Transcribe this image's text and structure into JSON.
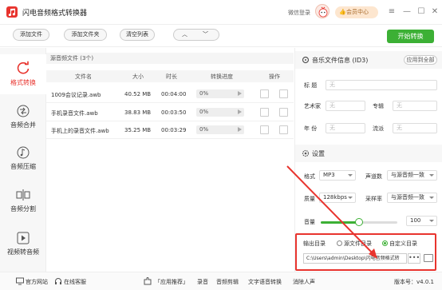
{
  "app": {
    "title": "闪电音频格式转换器",
    "wechat_login": "微信登录",
    "vip_center": "会员中心",
    "min_icon": "minimize-icon",
    "max_icon": "maximize-icon",
    "close_icon": "close-icon"
  },
  "toolbar": {
    "add_file": "添加文件",
    "add_folder": "添加文件夹",
    "clear_list": "清空列表",
    "up": "︿",
    "down": "﹀",
    "start": "开始转换"
  },
  "sidebar": {
    "items": [
      {
        "label": "格式转换",
        "icon": "refresh-icon",
        "active": true
      },
      {
        "label": "音频合并",
        "icon": "merge-icon",
        "active": false
      },
      {
        "label": "音频压缩",
        "icon": "music-note-icon",
        "active": false
      },
      {
        "label": "音频分割",
        "icon": "split-icon",
        "active": false
      },
      {
        "label": "视频转音频",
        "icon": "play-icon",
        "active": false
      }
    ]
  },
  "filelist": {
    "header": "源音频文件 (3个)",
    "columns": [
      "文件名",
      "大小",
      "时长",
      "转换进度",
      "操作"
    ],
    "rows": [
      {
        "name": "1009会议记录.awb",
        "size": "40.52 MB",
        "duration": "00:04:00",
        "progress": "0%",
        "progress_value": 0
      },
      {
        "name": "手机录音文件.awb",
        "size": "38.83 MB",
        "duration": "00:03:50",
        "progress": "0%",
        "progress_value": 0
      },
      {
        "name": "手机上的录音文件.awb",
        "size": "35.25 MB",
        "duration": "00:03:29",
        "progress": "0%",
        "progress_value": 0
      }
    ]
  },
  "info": {
    "title": "音乐文件信息 (ID3)",
    "apply_all": "应用到全部",
    "title_label": "标  题",
    "title_value": "无",
    "artist_label": "艺术家",
    "artist_value": "无",
    "album_label": "专辑",
    "album_value": "无",
    "year_label": "年  份",
    "year_value": "无",
    "genre_label": "流派",
    "genre_value": "无"
  },
  "settings": {
    "title": "设置",
    "format_label": "格式",
    "format_value": "MP3",
    "channels_label": "声道数",
    "channels_value": "与源音频一致",
    "quality_label": "质量",
    "quality_value": "128kbps",
    "samplerate_label": "采样率",
    "samplerate_value": "与源音频一致",
    "volume_label": "音量",
    "volume_value": "100",
    "volume_fraction": 0.5
  },
  "output": {
    "label": "输出目录",
    "opt_source": "源文件目录",
    "opt_custom": "自定义目录",
    "selected": "custom",
    "path": "C:\\Users\\admin\\Desktop\\闪电音频格式转",
    "browse": "•••"
  },
  "footer": {
    "website": "官方网站",
    "support": "在线客服",
    "recommend": "「应用推荐」",
    "rec1": "录音",
    "rec2": "音频剪辑",
    "rec3": "文字语音转换",
    "rec4": "消除人声",
    "version": "版本号：v4.0.1"
  },
  "colors": {
    "accent": "#e8342e",
    "green": "#3cb035"
  }
}
